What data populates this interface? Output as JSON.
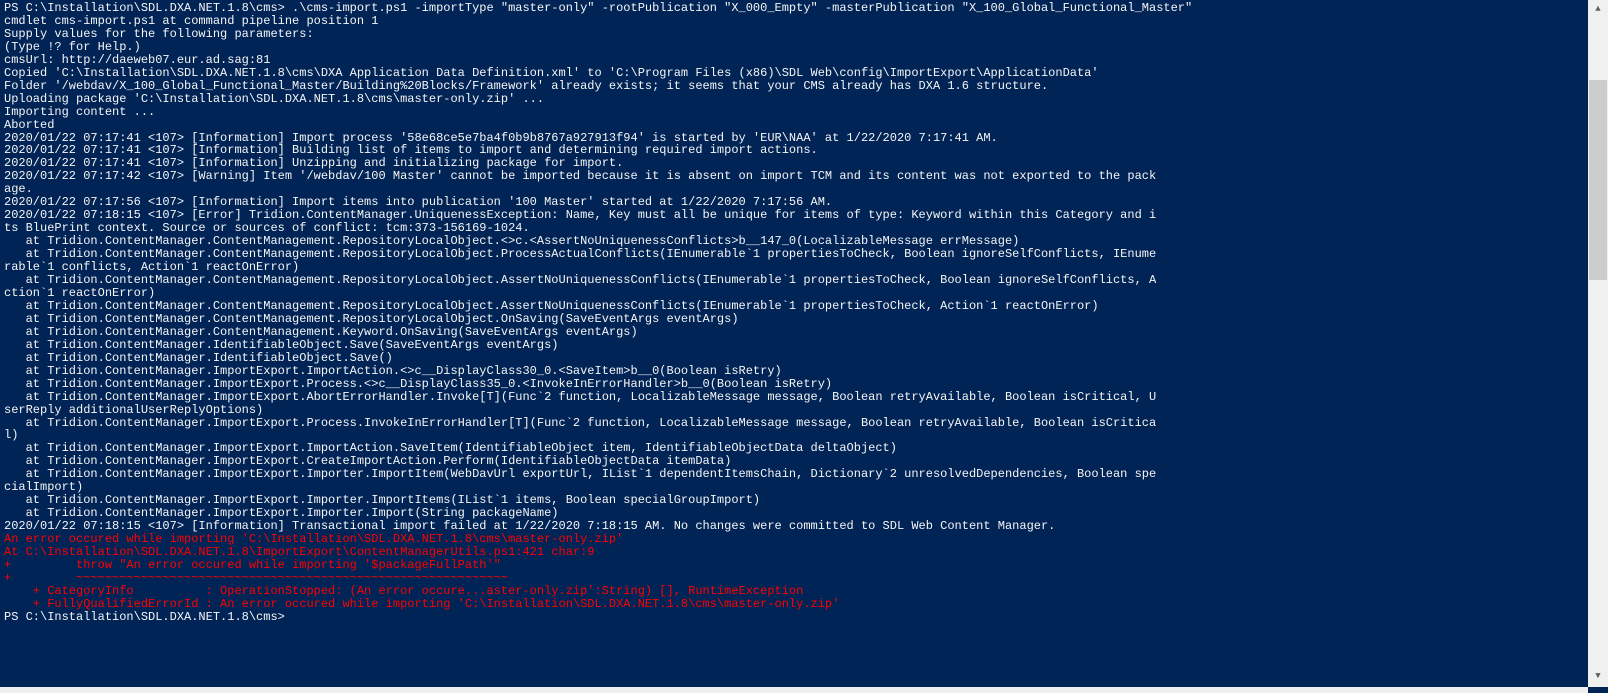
{
  "lines": [
    {
      "cls": "line",
      "t": "PS C:\\Installation\\SDL.DXA.NET.1.8\\cms> .\\cms-import.ps1 -importType \"master-only\" -rootPublication \"X_000_Empty\" -masterPublication \"X_100_Global_Functional_Master\""
    },
    {
      "cls": "line",
      "t": "cmdlet cms-import.ps1 at command pipeline position 1"
    },
    {
      "cls": "line",
      "t": "Supply values for the following parameters:"
    },
    {
      "cls": "line",
      "t": "(Type !? for Help.)"
    },
    {
      "cls": "line",
      "t": "cmsUrl: http://daeweb07.eur.ad.sag:81"
    },
    {
      "cls": "line",
      "t": "Copied 'C:\\Installation\\SDL.DXA.NET.1.8\\cms\\DXA Application Data Definition.xml' to 'C:\\Program Files (x86)\\SDL Web\\config\\ImportExport\\ApplicationData'"
    },
    {
      "cls": "line",
      "t": "Folder '/webdav/X_100_Global_Functional_Master/Building%20Blocks/Framework' already exists; it seems that your CMS already has DXA 1.6 structure."
    },
    {
      "cls": "line",
      "t": "Uploading package 'C:\\Installation\\SDL.DXA.NET.1.8\\cms\\master-only.zip' ..."
    },
    {
      "cls": "line",
      "t": "Importing content ..."
    },
    {
      "cls": "line",
      "t": "Aborted"
    },
    {
      "cls": "line",
      "t": "2020/01/22 07:17:41 <107> [Information] Import process '58e68ce5e7ba4f0b9b8767a927913f94' is started by 'EUR\\NAA' at 1/22/2020 7:17:41 AM."
    },
    {
      "cls": "line",
      "t": "2020/01/22 07:17:41 <107> [Information] Building list of items to import and determining required import actions."
    },
    {
      "cls": "line",
      "t": "2020/01/22 07:17:41 <107> [Information] Unzipping and initializing package for import."
    },
    {
      "cls": "line",
      "t": "2020/01/22 07:17:42 <107> [Warning] Item '/webdav/100 Master' cannot be imported because it is absent on import TCM and its content was not exported to the pack"
    },
    {
      "cls": "line",
      "t": "age."
    },
    {
      "cls": "line",
      "t": "2020/01/22 07:17:56 <107> [Information] Import items into publication '100 Master' started at 1/22/2020 7:17:56 AM."
    },
    {
      "cls": "line",
      "t": "2020/01/22 07:18:15 <107> [Error] Tridion.ContentManager.UniquenessException: Name, Key must all be unique for items of type: Keyword within this Category and i"
    },
    {
      "cls": "line",
      "t": "ts BluePrint context. Source or sources of conflict: tcm:373-156169-1024."
    },
    {
      "cls": "line",
      "t": "   at Tridion.ContentManager.ContentManagement.RepositoryLocalObject.<>c.<AssertNoUniquenessConflicts>b__147_0(LocalizableMessage errMessage)"
    },
    {
      "cls": "line",
      "t": "   at Tridion.ContentManager.ContentManagement.RepositoryLocalObject.ProcessActualConflicts(IEnumerable`1 propertiesToCheck, Boolean ignoreSelfConflicts, IEnume"
    },
    {
      "cls": "line",
      "t": "rable`1 conflicts, Action`1 reactOnError)"
    },
    {
      "cls": "line",
      "t": "   at Tridion.ContentManager.ContentManagement.RepositoryLocalObject.AssertNoUniquenessConflicts(IEnumerable`1 propertiesToCheck, Boolean ignoreSelfConflicts, A"
    },
    {
      "cls": "line",
      "t": "ction`1 reactOnError)"
    },
    {
      "cls": "line",
      "t": "   at Tridion.ContentManager.ContentManagement.RepositoryLocalObject.AssertNoUniquenessConflicts(IEnumerable`1 propertiesToCheck, Action`1 reactOnError)"
    },
    {
      "cls": "line",
      "t": "   at Tridion.ContentManager.ContentManagement.RepositoryLocalObject.OnSaving(SaveEventArgs eventArgs)"
    },
    {
      "cls": "line",
      "t": "   at Tridion.ContentManager.ContentManagement.Keyword.OnSaving(SaveEventArgs eventArgs)"
    },
    {
      "cls": "line",
      "t": "   at Tridion.ContentManager.IdentifiableObject.Save(SaveEventArgs eventArgs)"
    },
    {
      "cls": "line",
      "t": "   at Tridion.ContentManager.IdentifiableObject.Save()"
    },
    {
      "cls": "line",
      "t": "   at Tridion.ContentManager.ImportExport.ImportAction.<>c__DisplayClass30_0.<SaveItem>b__0(Boolean isRetry)"
    },
    {
      "cls": "line",
      "t": "   at Tridion.ContentManager.ImportExport.Process.<>c__DisplayClass35_0.<InvokeInErrorHandler>b__0(Boolean isRetry)"
    },
    {
      "cls": "line",
      "t": "   at Tridion.ContentManager.ImportExport.AbortErrorHandler.Invoke[T](Func`2 function, LocalizableMessage message, Boolean retryAvailable, Boolean isCritical, U"
    },
    {
      "cls": "line",
      "t": "serReply additionalUserReplyOptions)"
    },
    {
      "cls": "line",
      "t": "   at Tridion.ContentManager.ImportExport.Process.InvokeInErrorHandler[T](Func`2 function, LocalizableMessage message, Boolean retryAvailable, Boolean isCritica"
    },
    {
      "cls": "line",
      "t": "l)"
    },
    {
      "cls": "line",
      "t": "   at Tridion.ContentManager.ImportExport.ImportAction.SaveItem(IdentifiableObject item, IdentifiableObjectData deltaObject)"
    },
    {
      "cls": "line",
      "t": "   at Tridion.ContentManager.ImportExport.CreateImportAction.Perform(IdentifiableObjectData itemData)"
    },
    {
      "cls": "line",
      "t": "   at Tridion.ContentManager.ImportExport.Importer.ImportItem(WebDavUrl exportUrl, IList`1 dependentItemsChain, Dictionary`2 unresolvedDependencies, Boolean spe"
    },
    {
      "cls": "line",
      "t": "cialImport)"
    },
    {
      "cls": "line",
      "t": "   at Tridion.ContentManager.ImportExport.Importer.ImportItems(IList`1 items, Boolean specialGroupImport)"
    },
    {
      "cls": "line",
      "t": "   at Tridion.ContentManager.ImportExport.Importer.Import(String packageName)"
    },
    {
      "cls": "line",
      "t": "2020/01/22 07:18:15 <107> [Information] Transactional import failed at 1/22/2020 7:18:15 AM. No changes were committed to SDL Web Content Manager."
    },
    {
      "cls": "error-line",
      "t": "An error occured while importing 'C:\\Installation\\SDL.DXA.NET.1.8\\cms\\master-only.zip'"
    },
    {
      "cls": "error-line",
      "t": "At C:\\Installation\\SDL.DXA.NET.1.8\\ImportExport\\ContentManagerUtils.ps1:421 char:9"
    },
    {
      "cls": "error-line",
      "t": "+         throw \"An error occured while importing '$packageFullPath'\""
    },
    {
      "cls": "error-line",
      "t": "+         ~~~~~~~~~~~~~~~~~~~~~~~~~~~~~~~~~~~~~~~~~~~~~~~~~~~~~~~~~~~~"
    },
    {
      "cls": "error-line",
      "t": "    + CategoryInfo          : OperationStopped: (An error occure...aster-only.zip':String) [], RuntimeException"
    },
    {
      "cls": "error-line",
      "t": "    + FullyQualifiedErrorId : An error occured while importing 'C:\\Installation\\SDL.DXA.NET.1.8\\cms\\master-only.zip'"
    },
    {
      "cls": "line",
      "t": ""
    },
    {
      "cls": "line",
      "t": "PS C:\\Installation\\SDL.DXA.NET.1.8\\cms>"
    }
  ],
  "scroll": {
    "upArrow": "▲",
    "downArrow": "▼"
  }
}
